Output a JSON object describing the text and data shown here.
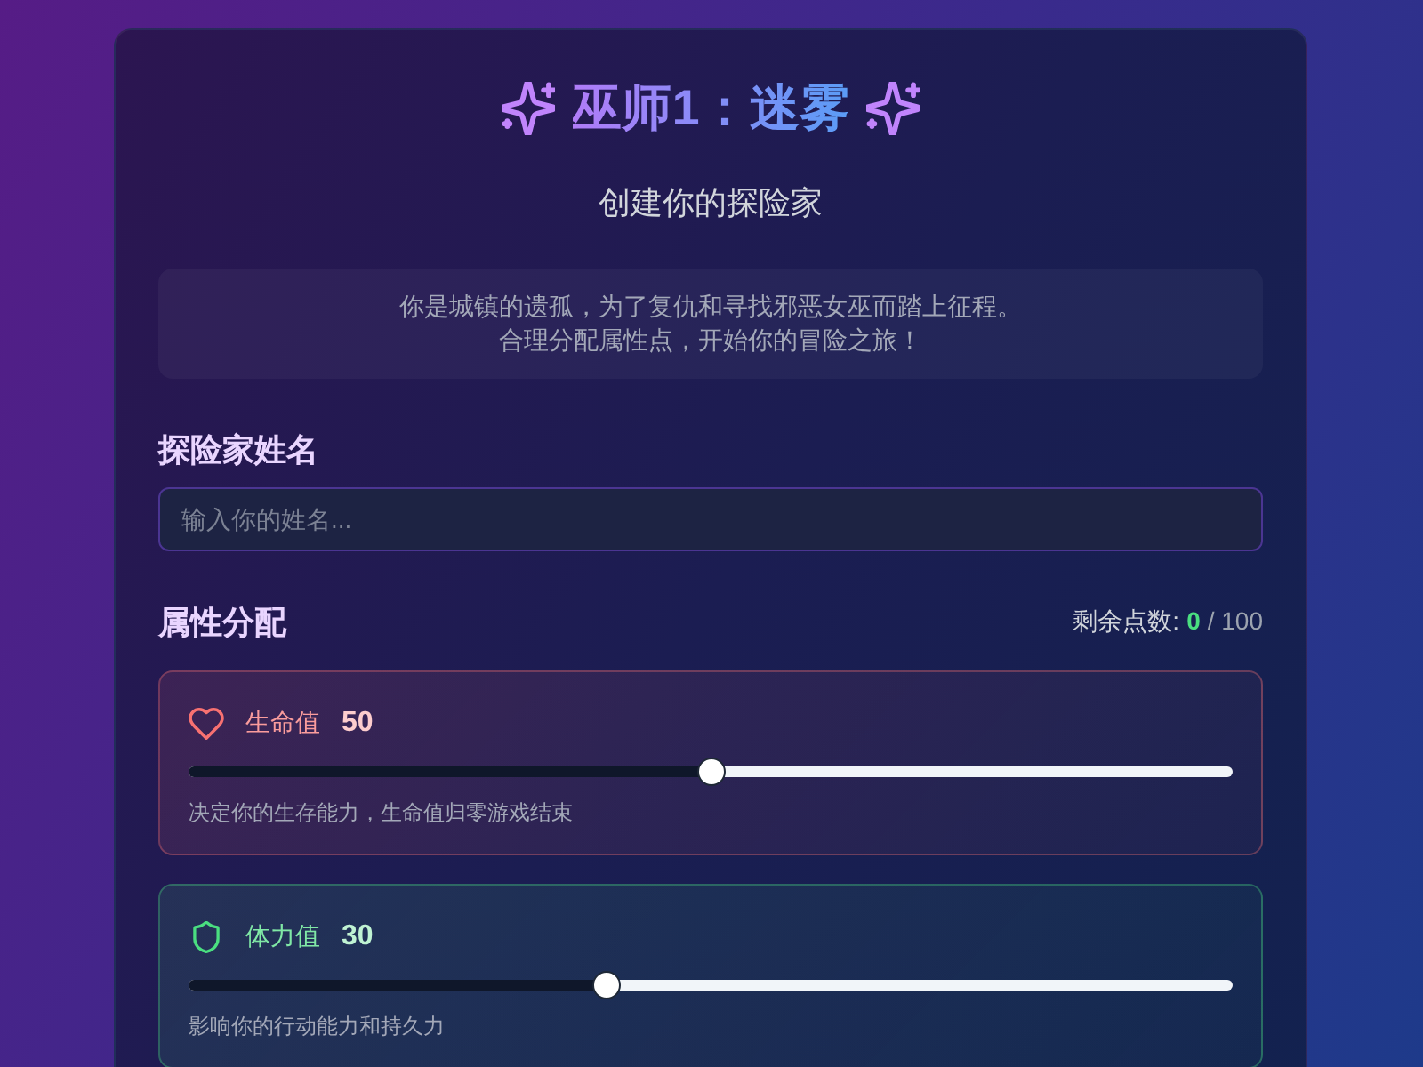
{
  "header": {
    "title": "巫师1：迷雾",
    "subtitle": "创建你的探险家"
  },
  "intro": {
    "lines": [
      "你是城镇的遗孤，为了复仇和寻找邪恶女巫而踏上征程。",
      "合理分配属性点，开始你的冒险之旅！"
    ]
  },
  "name_field": {
    "label": "探险家姓名",
    "placeholder": "输入你的姓名..."
  },
  "attributes": {
    "title": "属性分配",
    "remaining": {
      "label": "剩余点数:",
      "value": "0",
      "total": "/ 100"
    },
    "items": [
      {
        "kind": "health",
        "name": "生命值",
        "value": "50",
        "color": "#f87171",
        "level": 0.5,
        "description": "决定你的生存能力，生命值归零游戏结束"
      },
      {
        "kind": "stamina",
        "name": "体力值",
        "value": "30",
        "color": "#4ade80",
        "level": 0.4,
        "description": "影响你的行动能力和持久力"
      }
    ]
  }
}
